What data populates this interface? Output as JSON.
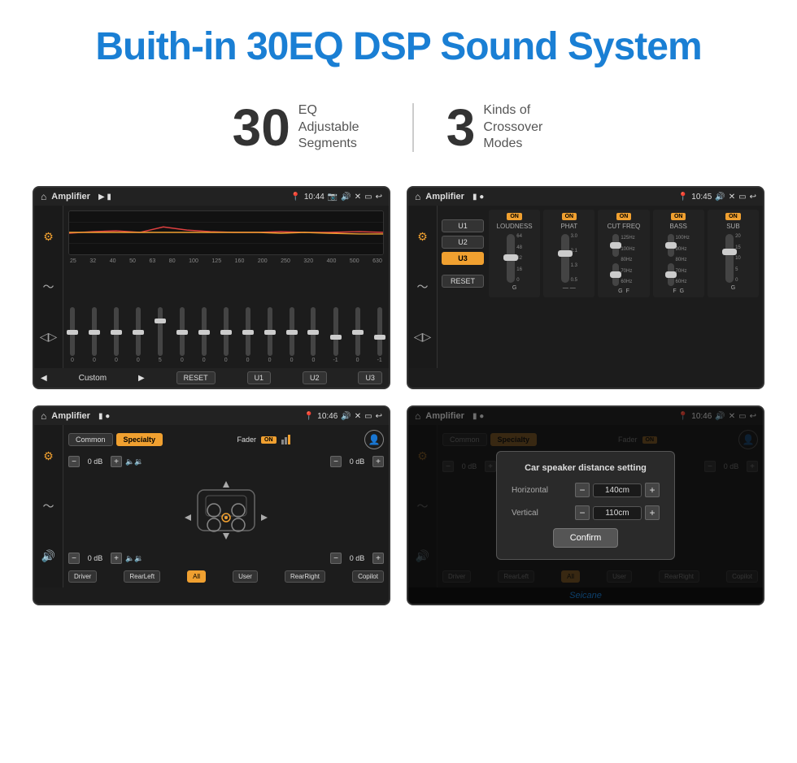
{
  "page": {
    "title": "Buith-in 30EQ DSP Sound System",
    "stat1_number": "30",
    "stat1_label": "EQ Adjustable\nSegments",
    "stat2_number": "3",
    "stat2_label": "Kinds of\nCrossover Modes"
  },
  "screen1": {
    "app_title": "Amplifier",
    "time": "10:44",
    "freqs": [
      "25",
      "32",
      "40",
      "50",
      "63",
      "80",
      "100",
      "125",
      "160",
      "200",
      "250",
      "320",
      "400",
      "500",
      "630"
    ],
    "values": [
      "0",
      "0",
      "0",
      "0",
      "5",
      "0",
      "0",
      "0",
      "0",
      "0",
      "0",
      "0",
      "-1",
      "0",
      "-1"
    ],
    "preset": "Custom",
    "buttons": [
      "RESET",
      "U1",
      "U2",
      "U3"
    ]
  },
  "screen2": {
    "app_title": "Amplifier",
    "time": "10:45",
    "u_buttons": [
      "U1",
      "U2",
      "U3"
    ],
    "u3_active": true,
    "channels": [
      {
        "label": "LOUDNESS",
        "on": true,
        "g": "G"
      },
      {
        "label": "PHAT",
        "on": true,
        "g": ""
      },
      {
        "label": "CUT FREQ",
        "on": true,
        "g": "G",
        "f": "F"
      },
      {
        "label": "BASS",
        "on": true,
        "g": "G",
        "f": "F"
      },
      {
        "label": "SUB",
        "on": true,
        "g": "G"
      }
    ],
    "reset_label": "RESET"
  },
  "screen3": {
    "app_title": "Amplifier",
    "time": "10:46",
    "common_btn": "Common",
    "specialty_btn": "Specialty",
    "fader_label": "Fader",
    "fader_on": "ON",
    "db_values": [
      "0 dB",
      "0 dB",
      "0 dB",
      "0 dB"
    ],
    "preset_btns": [
      "Driver",
      "RearLeft",
      "All",
      "User",
      "RearRight",
      "Copilot"
    ]
  },
  "screen4": {
    "app_title": "Amplifier",
    "time": "10:46",
    "common_btn": "Common",
    "specialty_btn": "Specialty",
    "dialog_title": "Car speaker distance setting",
    "horizontal_label": "Horizontal",
    "horizontal_value": "140cm",
    "vertical_label": "Vertical",
    "vertical_value": "110cm",
    "confirm_btn": "Confirm",
    "db_values": [
      "0 dB",
      "0 dB"
    ],
    "preset_btns": [
      "Driver",
      "RearLeft",
      "All",
      "User",
      "RearRight",
      "Copilot"
    ],
    "watermark": "Seicane"
  }
}
